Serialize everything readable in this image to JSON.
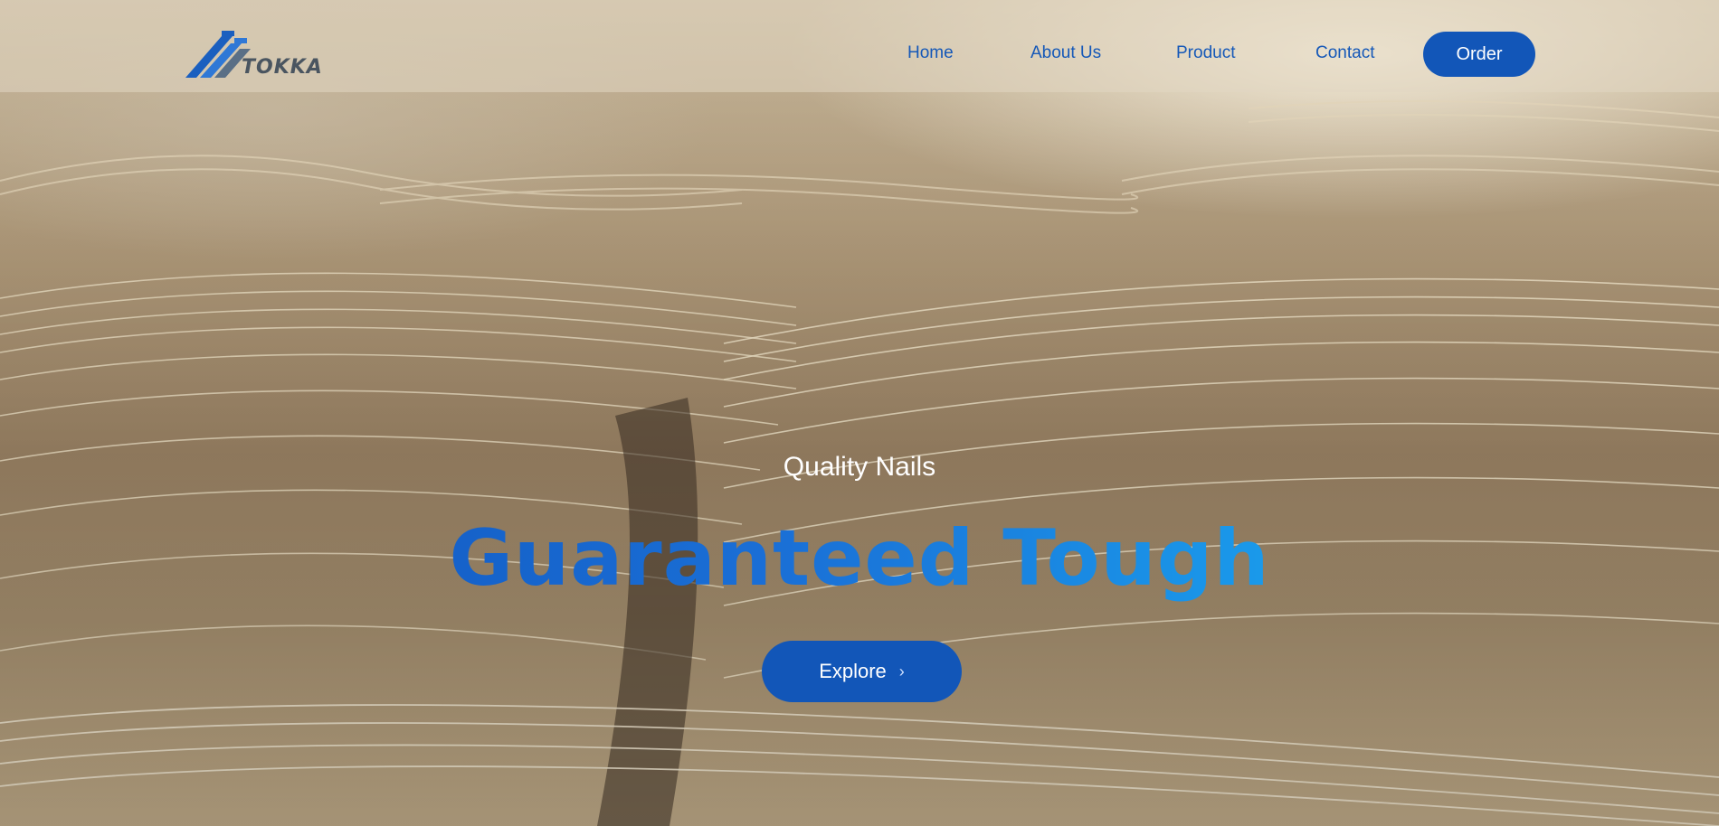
{
  "brand": {
    "logo_text": "TOKKA",
    "logo_color": "#1a5fbf"
  },
  "nav": {
    "items": [
      {
        "label": "Home"
      },
      {
        "label": "About Us"
      },
      {
        "label": "Product"
      },
      {
        "label": "Contact"
      }
    ],
    "order_label": "Order"
  },
  "hero": {
    "subtitle": "Quality Nails",
    "headline": "Guaranteed Tough",
    "cta_label": "Explore",
    "cta_icon": "chevron-right-icon",
    "background": "steel wire coils"
  },
  "colors": {
    "accent": "#1256b8",
    "headline_gradient_start": "#0f4fb8",
    "headline_gradient_end": "#20b0f5"
  }
}
